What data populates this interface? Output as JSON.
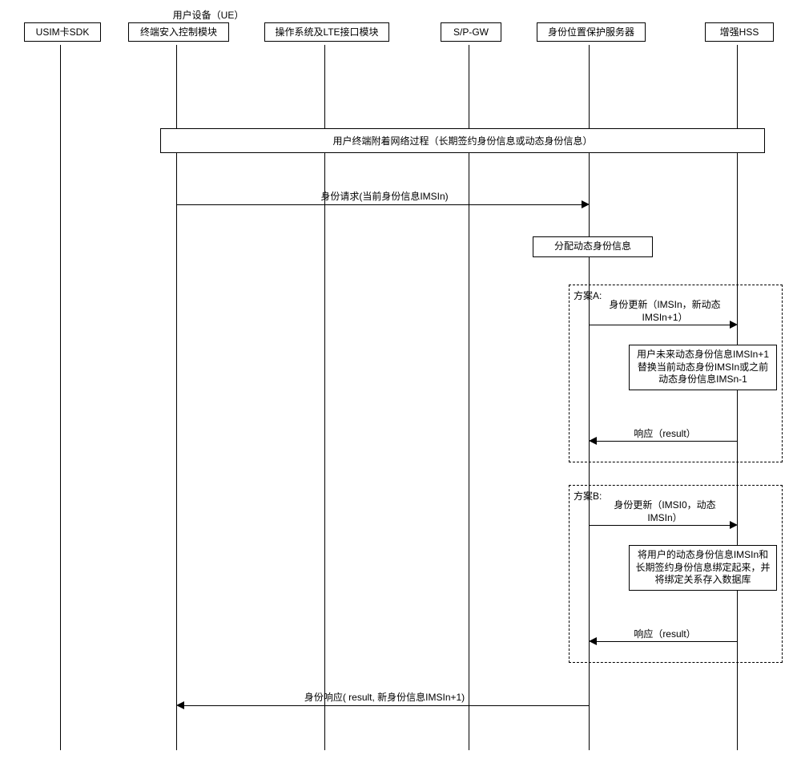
{
  "actors": {
    "ue_group": "用户设备（UE）",
    "usim": "USIM卡SDK",
    "access": "终端安入控制模块",
    "os_lte": "操作系统及LTE接口模块",
    "spgw": "S/P-GW",
    "id_server": "身份位置保护服务器",
    "hss": "增强HSS"
  },
  "steps": {
    "attach": "用户终端附着网络过程（长期签约身份信息或动态身份信息）",
    "id_request": "身份请求(当前身份信息IMSIn)",
    "alloc": "分配动态身份信息",
    "planA_label": "方案A:",
    "planA_update": "身份更新（IMSIn，新动态IMSIn+1）",
    "planA_process": "用户未来动态身份信息IMSIn+1替换当前动态身份IMSIn或之前动态身份信息IMSn-1",
    "planA_response": "响应（result）",
    "planB_label": "方案B:",
    "planB_update": "身份更新（IMSI0，动态IMSIn）",
    "planB_process": "将用户的动态身份信息IMSIn和长期签约身份信息绑定起来，并将绑定关系存入数据库",
    "planB_response": "响应（result）",
    "id_response": "身份响应( result, 新身份信息IMSIn+1)"
  }
}
